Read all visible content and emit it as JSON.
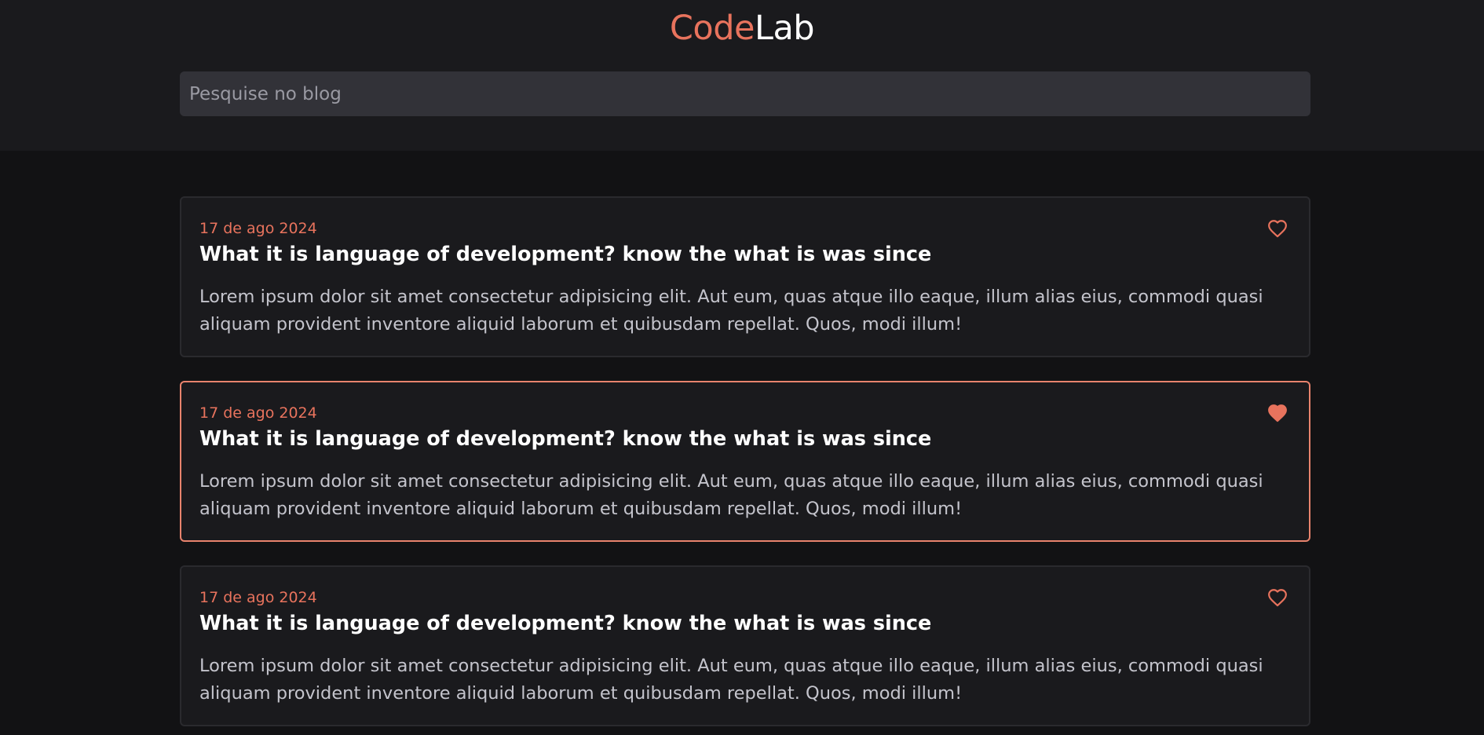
{
  "header": {
    "logo_part1": "Code",
    "logo_part2": "Lab"
  },
  "search": {
    "placeholder": "Pesquise no blog",
    "value": ""
  },
  "posts": [
    {
      "date": "17 de ago 2024",
      "title": "What it is language of development? know the what is was since",
      "excerpt": "Lorem ipsum dolor sit amet consectetur adipisicing elit. Aut eum, quas atque illo eaque, illum alias eius, commodi quasi aliquam provident inventore aliquid laborum et quibusdam repellat. Quos, modi illum!",
      "liked": false,
      "highlighted": false
    },
    {
      "date": "17 de ago 2024",
      "title": "What it is language of development? know the what is was since",
      "excerpt": "Lorem ipsum dolor sit amet consectetur adipisicing elit. Aut eum, quas atque illo eaque, illum alias eius, commodi quasi aliquam provident inventore aliquid laborum et quibusdam repellat. Quos, modi illum!",
      "liked": true,
      "highlighted": true
    },
    {
      "date": "17 de ago 2024",
      "title": "What it is language of development? know the what is was since",
      "excerpt": "Lorem ipsum dolor sit amet consectetur adipisicing elit. Aut eum, quas atque illo eaque, illum alias eius, commodi quasi aliquam provident inventore aliquid laborum et quibusdam repellat. Quos, modi illum!",
      "liked": false,
      "highlighted": false
    }
  ],
  "colors": {
    "accent": "#e8735d",
    "background": "#121214",
    "header_background": "#1a1a1d",
    "card_background": "#1a1a1d",
    "card_border": "#2a2a2e",
    "card_border_active": "#e8836d",
    "search_background": "#323238"
  },
  "icons": {
    "like": "heart-icon"
  }
}
